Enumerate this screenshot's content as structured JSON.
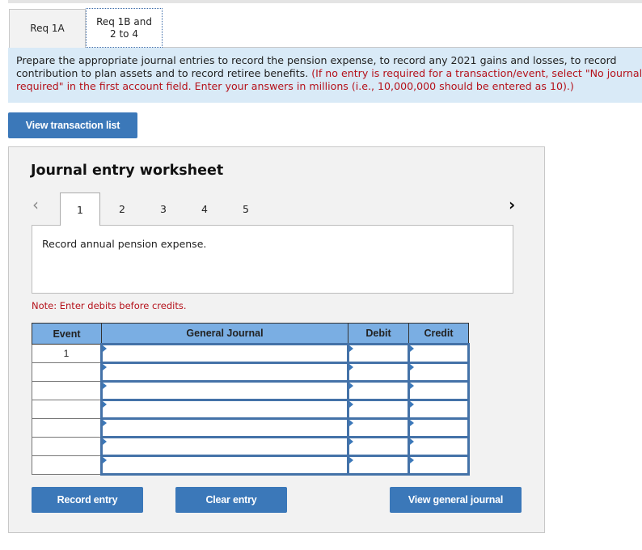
{
  "tabs": [
    {
      "label": "Req 1A",
      "active": false
    },
    {
      "label": "Req 1B and 2 to 4",
      "active": true
    }
  ],
  "instructions": {
    "line1": "Prepare the appropriate journal entries to record the pension expense, to record any 2021 gains and losses, to record",
    "line2_black": "contribution to plan assets and to record retiree benefits. ",
    "line2_red": "(If no entry is required for a transaction/event, select \"No journal entry",
    "line3_red": "required\" in the first account field. Enter your answers in millions (i.e., 10,000,000 should be entered as 10).)"
  },
  "buttons": {
    "view_transaction_list": "View transaction list",
    "record_entry": "Record entry",
    "clear_entry": "Clear entry",
    "view_general_journal": "View general journal"
  },
  "worksheet": {
    "title": "Journal entry worksheet",
    "nav_prev_icon": "‹",
    "nav_next_icon": "›",
    "steps": [
      "1",
      "2",
      "3",
      "4",
      "5"
    ],
    "active_step": "1",
    "description": "Record annual pension expense.",
    "note": "Note: Enter debits before credits."
  },
  "journal_table": {
    "headers": {
      "event": "Event",
      "general_journal": "General Journal",
      "debit": "Debit",
      "credit": "Credit"
    },
    "rows": [
      {
        "event": "1",
        "account": "",
        "debit": "",
        "credit": ""
      },
      {
        "event": "",
        "account": "",
        "debit": "",
        "credit": ""
      },
      {
        "event": "",
        "account": "",
        "debit": "",
        "credit": ""
      },
      {
        "event": "",
        "account": "",
        "debit": "",
        "credit": ""
      },
      {
        "event": "",
        "account": "",
        "debit": "",
        "credit": ""
      },
      {
        "event": "",
        "account": "",
        "debit": "",
        "credit": ""
      },
      {
        "event": "",
        "account": "",
        "debit": "",
        "credit": ""
      }
    ]
  },
  "colors": {
    "accent_button": "#3b78b9",
    "instructions_bg": "#d9eaf7",
    "table_header_bg": "#7aaee3",
    "warning_text": "#b5121b"
  }
}
